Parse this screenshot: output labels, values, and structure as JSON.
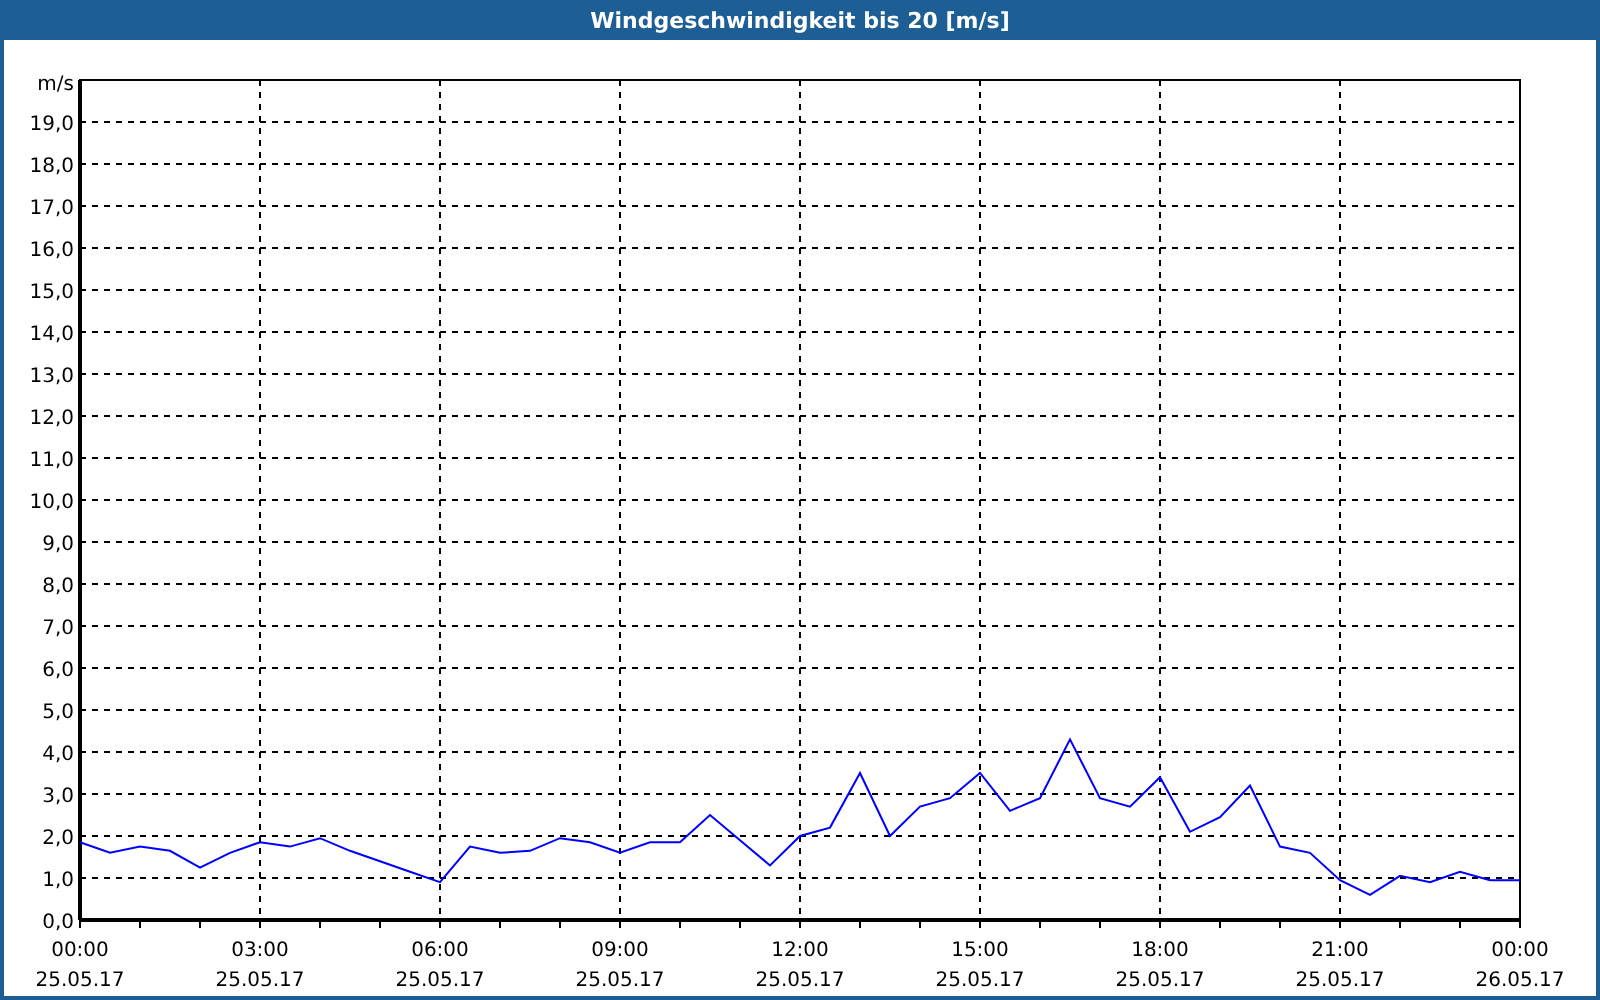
{
  "window": {
    "title": "Windgeschwindigkeit bis 20 [m/s]"
  },
  "chart": {
    "date_labels": [
      "25.05.17",
      "25.05.17",
      "25.05.17",
      "25.05.17",
      "25.05.17",
      "25.05.17",
      "25.05.17",
      "25.05.17",
      "26.05.17"
    ],
    "chart_data": {
      "type": "line",
      "ylabel": "m/s",
      "ylim": [
        0,
        20
      ],
      "grid": true,
      "yticks": [
        {
          "value": 0,
          "label": "0,0"
        },
        {
          "value": 1,
          "label": "1,0"
        },
        {
          "value": 2,
          "label": "2,0"
        },
        {
          "value": 3,
          "label": "3,0"
        },
        {
          "value": 4,
          "label": "4,0"
        },
        {
          "value": 5,
          "label": "5,0"
        },
        {
          "value": 6,
          "label": "6,0"
        },
        {
          "value": 7,
          "label": "7,0"
        },
        {
          "value": 8,
          "label": "8,0"
        },
        {
          "value": 9,
          "label": "9,0"
        },
        {
          "value": 10,
          "label": "10,0"
        },
        {
          "value": 11,
          "label": "11,0"
        },
        {
          "value": 12,
          "label": "12,0"
        },
        {
          "value": 13,
          "label": "13,0"
        },
        {
          "value": 14,
          "label": "14,0"
        },
        {
          "value": 15,
          "label": "15,0"
        },
        {
          "value": 16,
          "label": "16,0"
        },
        {
          "value": 17,
          "label": "17,0"
        },
        {
          "value": 18,
          "label": "18,0"
        },
        {
          "value": 19,
          "label": "19,0"
        }
      ],
      "categories": [
        "00:00",
        null,
        null,
        null,
        null,
        null,
        "03:00",
        null,
        null,
        null,
        null,
        null,
        "06:00",
        null,
        null,
        null,
        null,
        null,
        "09:00",
        null,
        null,
        null,
        null,
        null,
        "12:00",
        null,
        null,
        null,
        null,
        null,
        "15:00",
        null,
        null,
        null,
        null,
        null,
        "18:00",
        null,
        null,
        null,
        null,
        null,
        "21:00",
        null,
        null,
        null,
        null,
        null,
        "00:00"
      ],
      "series": [
        {
          "color": "#0000ff",
          "values": [
            1.85,
            1.6,
            1.75,
            1.65,
            1.25,
            1.6,
            1.85,
            1.75,
            1.95,
            1.65,
            1.4,
            1.15,
            0.9,
            1.75,
            1.6,
            1.65,
            1.95,
            1.85,
            1.6,
            1.85,
            1.85,
            2.5,
            1.9,
            1.3,
            2.0,
            2.2,
            3.5,
            2.0,
            2.7,
            2.9,
            3.5,
            2.6,
            2.9,
            4.3,
            2.9,
            2.7,
            3.4,
            2.1,
            2.45,
            3.2,
            1.75,
            1.6,
            0.95,
            0.6,
            1.05,
            0.9,
            1.15,
            0.95,
            0.95
          ]
        }
      ]
    }
  }
}
